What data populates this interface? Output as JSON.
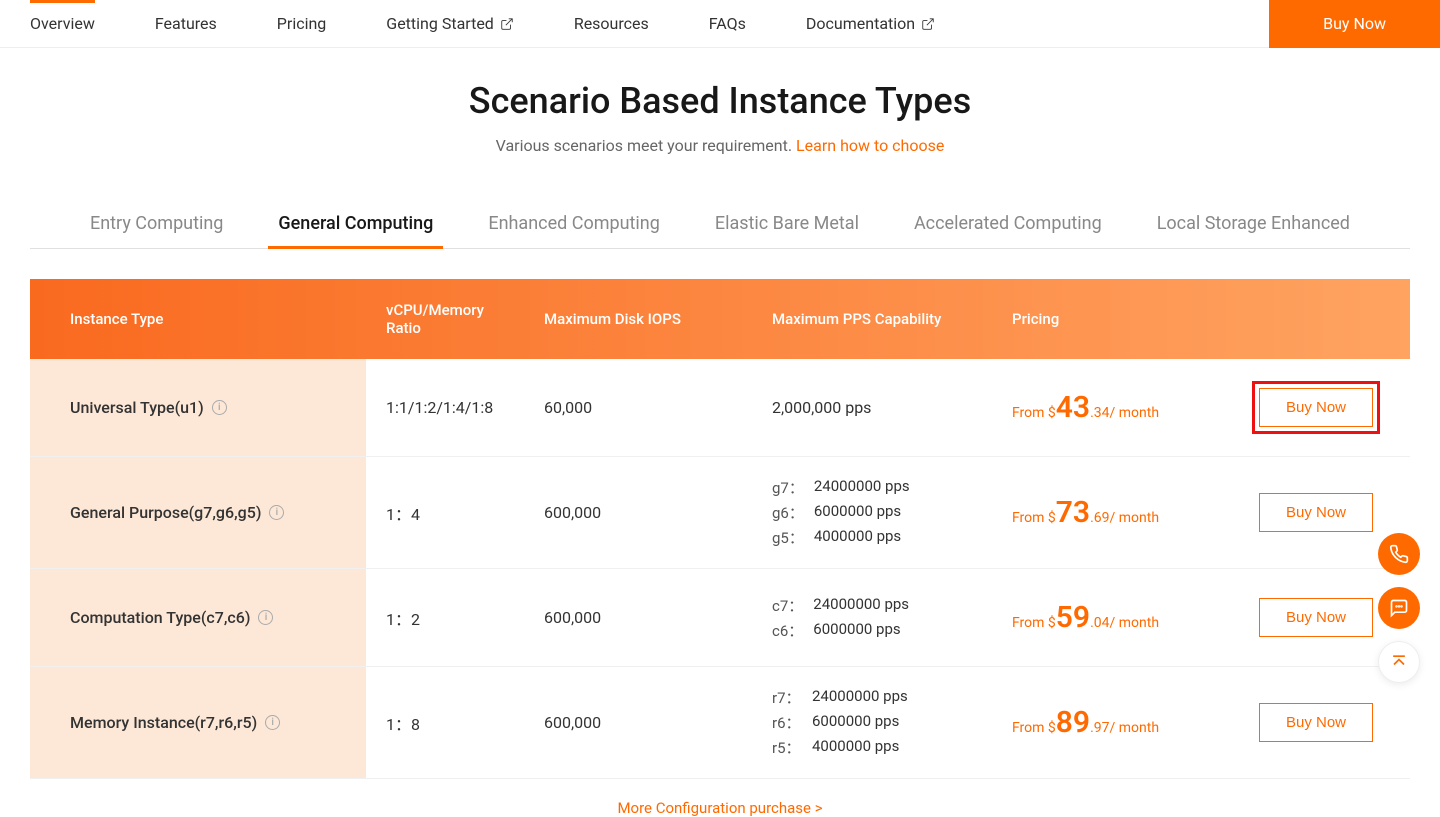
{
  "nav": {
    "overview": "Overview",
    "features": "Features",
    "pricing": "Pricing",
    "getting_started": "Getting Started",
    "resources": "Resources",
    "faqs": "FAQs",
    "documentation": "Documentation",
    "buy_now": "Buy Now"
  },
  "page": {
    "title": "Scenario Based Instance Types",
    "subtitle_text": "Various scenarios meet your requirement. ",
    "subtitle_link": "Learn how to choose"
  },
  "categories": {
    "entry": "Entry Computing",
    "general": "General Computing",
    "enhanced": "Enhanced Computing",
    "bare_metal": "Elastic Bare Metal",
    "accelerated": "Accelerated Computing",
    "local_storage": "Local Storage Enhanced"
  },
  "table": {
    "headers": {
      "instance_type": "Instance Type",
      "ratio": "vCPU/Memory Ratio",
      "iops": "Maximum Disk IOPS",
      "pps": "Maximum PPS Capability",
      "pricing": "Pricing"
    },
    "buy_label": "Buy Now",
    "more_link": "More Configuration purchase >",
    "rows": [
      {
        "type": "Universal Type(u1)",
        "ratio": "1:1/1:2/1:4/1:8",
        "iops": "60,000",
        "pps_simple": "2,000,000 pps",
        "price_from": "From $",
        "price_big": "43",
        "price_suffix": ".34/ month",
        "highlighted": true
      },
      {
        "type": "General Purpose(g7,g6,g5)",
        "ratio": "1：4",
        "iops": "600,000",
        "pps": [
          {
            "label": "g7：",
            "value": "24000000 pps"
          },
          {
            "label": "g6：",
            "value": "6000000 pps"
          },
          {
            "label": "g5：",
            "value": "4000000 pps"
          }
        ],
        "price_from": "From $",
        "price_big": "73",
        "price_suffix": ".69/ month"
      },
      {
        "type": "Computation Type(c7,c6)",
        "ratio": "1：2",
        "iops": "600,000",
        "pps": [
          {
            "label": "c7：",
            "value": "24000000 pps"
          },
          {
            "label": "c6：",
            "value": "6000000 pps"
          }
        ],
        "price_from": "From $",
        "price_big": "59",
        "price_suffix": ".04/ month"
      },
      {
        "type": "Memory Instance(r7,r6,r5)",
        "ratio": "1：8",
        "iops": "600,000",
        "pps": [
          {
            "label": "r7：",
            "value": "24000000 pps"
          },
          {
            "label": "r6：",
            "value": "6000000 pps"
          },
          {
            "label": "r5：",
            "value": "4000000 pps"
          }
        ],
        "price_from": "From $",
        "price_big": "89",
        "price_suffix": ".97/ month"
      }
    ]
  }
}
